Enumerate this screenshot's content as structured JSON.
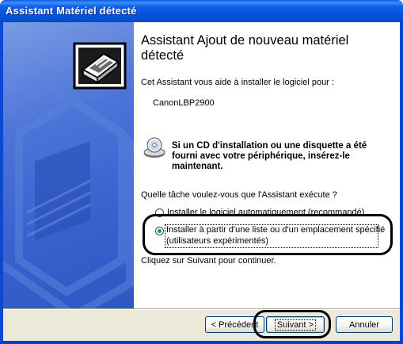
{
  "window": {
    "title": "Assistant Matériel détecté"
  },
  "page": {
    "heading": "Assistant Ajout de nouveau matériel détecté",
    "intro": "Cet Assistant vous aide à installer le logiciel pour :",
    "device": "CanonLBP2900",
    "cd_notice": "Si un CD d'installation ou une disquette a été fourni avec votre périphérique, insérez-le maintenant.",
    "question": "Quelle tâche voulez-vous que l'Assistant exécute ?",
    "option_auto": "Installer le logiciel automatiquement (recommandé)",
    "option_manual_line1": "Installer à partir d'une liste ou d'un emplacement spécifié",
    "option_manual_line2": "(utilisateurs expérimentés)",
    "continue_hint": "Cliquez sur Suivant pour continuer.",
    "selected_option": "manual"
  },
  "buttons": {
    "back": "< Précédent",
    "next": "Suivant >",
    "cancel": "Annuler"
  },
  "icons": {
    "hardware": "hardware-device-icon",
    "cd": "cd-disk-icon"
  }
}
